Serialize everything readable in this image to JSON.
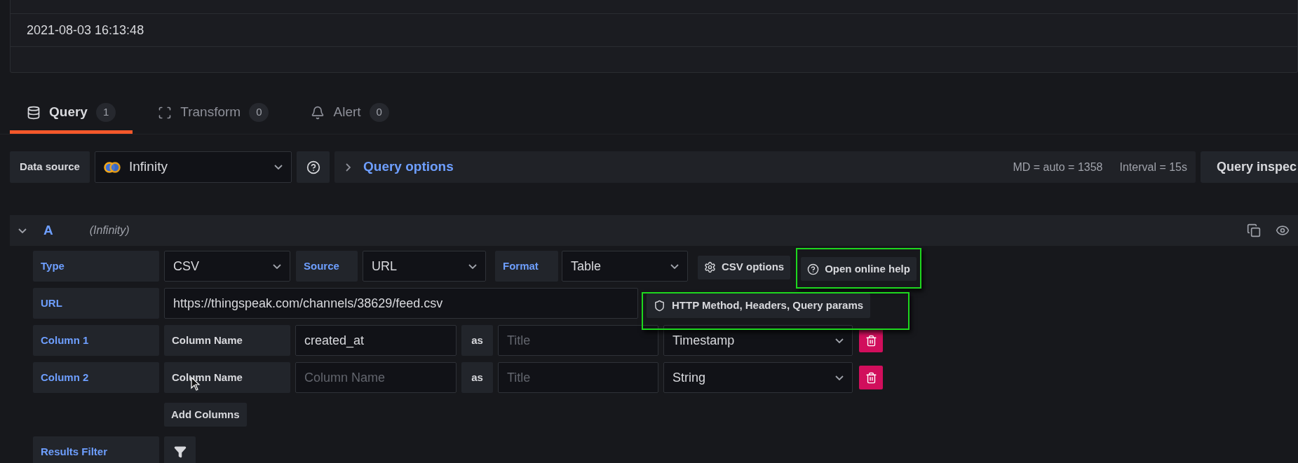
{
  "table": {
    "rows": [
      {
        "cell": "2021-08-03 16:13:48"
      }
    ]
  },
  "tabs": [
    {
      "kind": "database",
      "label": "Query",
      "count": "1",
      "selected": true
    },
    {
      "kind": "transform",
      "label": "Transform",
      "count": "0",
      "selected": false
    },
    {
      "kind": "bell",
      "label": "Alert",
      "count": "0",
      "selected": false
    }
  ],
  "data_source": {
    "label": "Data source",
    "value": "Infinity"
  },
  "query_options": {
    "label": "Query options",
    "expanded": false,
    "md": "MD = auto = 1358",
    "interval": "Interval = 15s"
  },
  "query_inspector": "Query inspec",
  "query": {
    "ref": "A",
    "datasource": "(Infinity)",
    "expanded": true
  },
  "editor": {
    "type": {
      "label": "Type",
      "value": "CSV"
    },
    "source": {
      "label": "Source",
      "value": "URL"
    },
    "format": {
      "label": "Format",
      "value": "Table"
    },
    "csv_options": "CSV options",
    "help": {
      "label": "Open online help",
      "highlighted": true
    },
    "url": {
      "label": "URL",
      "value": "https://thingspeak.com/channels/38629/feed.csv"
    },
    "http_button": {
      "label": "HTTP Method, Headers, Query params",
      "highlighted": true
    },
    "columns": [
      {
        "label": "Column 1",
        "name_label": "Column Name",
        "value": "created_at",
        "as": "as",
        "title_placeholder": "Title",
        "type": "Timestamp"
      },
      {
        "label": "Column 2",
        "name_label": "Column Name",
        "placeholder": "Column Name",
        "as": "as",
        "title_placeholder": "Title",
        "type": "String"
      }
    ],
    "add_columns": "Add Columns",
    "results_filter": "Results Filter"
  }
}
